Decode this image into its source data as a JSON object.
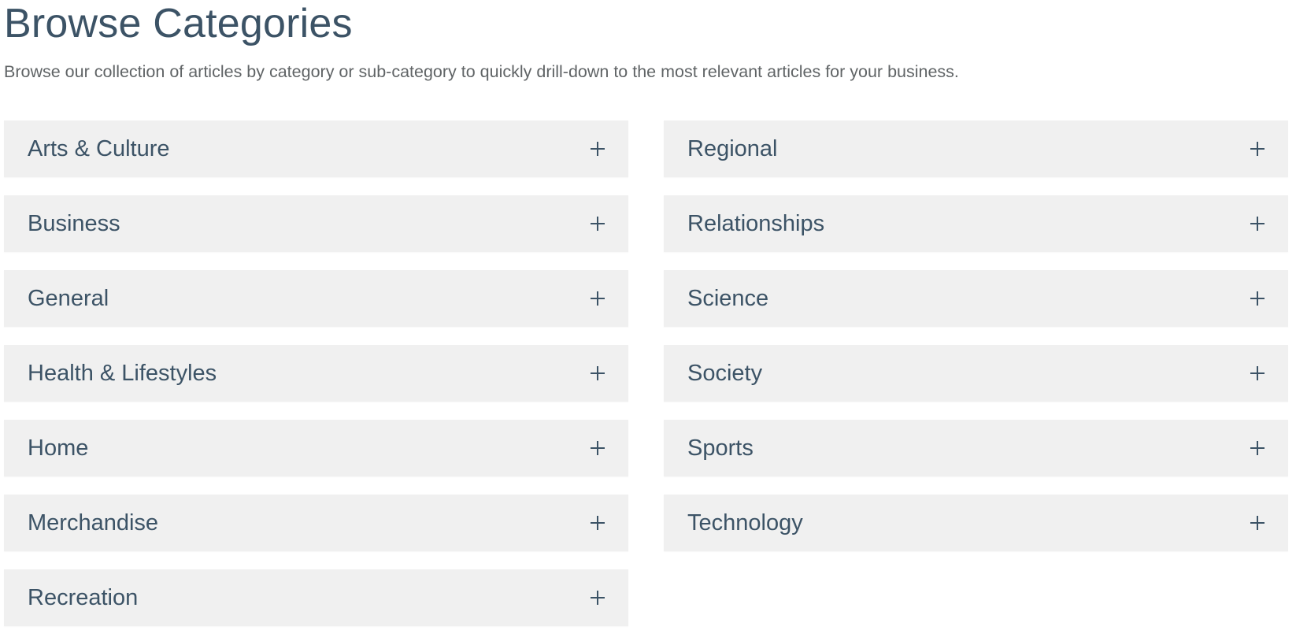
{
  "header": {
    "title": "Browse Categories",
    "subtitle": "Browse our collection of articles by category or sub-category to quickly drill-down to the most relevant articles for your business."
  },
  "categories": {
    "left": [
      {
        "label": "Arts & Culture",
        "icon": "plus-icon"
      },
      {
        "label": "Business",
        "icon": "plus-icon"
      },
      {
        "label": "General",
        "icon": "plus-icon"
      },
      {
        "label": "Health & Lifestyles",
        "icon": "plus-icon"
      },
      {
        "label": "Home",
        "icon": "plus-icon"
      },
      {
        "label": "Merchandise",
        "icon": "plus-icon"
      },
      {
        "label": "Recreation",
        "icon": "plus-icon"
      }
    ],
    "right": [
      {
        "label": "Regional",
        "icon": "plus-icon"
      },
      {
        "label": "Relationships",
        "icon": "plus-icon"
      },
      {
        "label": "Science",
        "icon": "plus-icon"
      },
      {
        "label": "Society",
        "icon": "plus-icon"
      },
      {
        "label": "Sports",
        "icon": "plus-icon"
      },
      {
        "label": "Technology",
        "icon": "plus-icon"
      }
    ]
  },
  "colors": {
    "heading": "#3c5366",
    "subtitle": "#606466",
    "panel_bg": "#f0f0f0"
  }
}
